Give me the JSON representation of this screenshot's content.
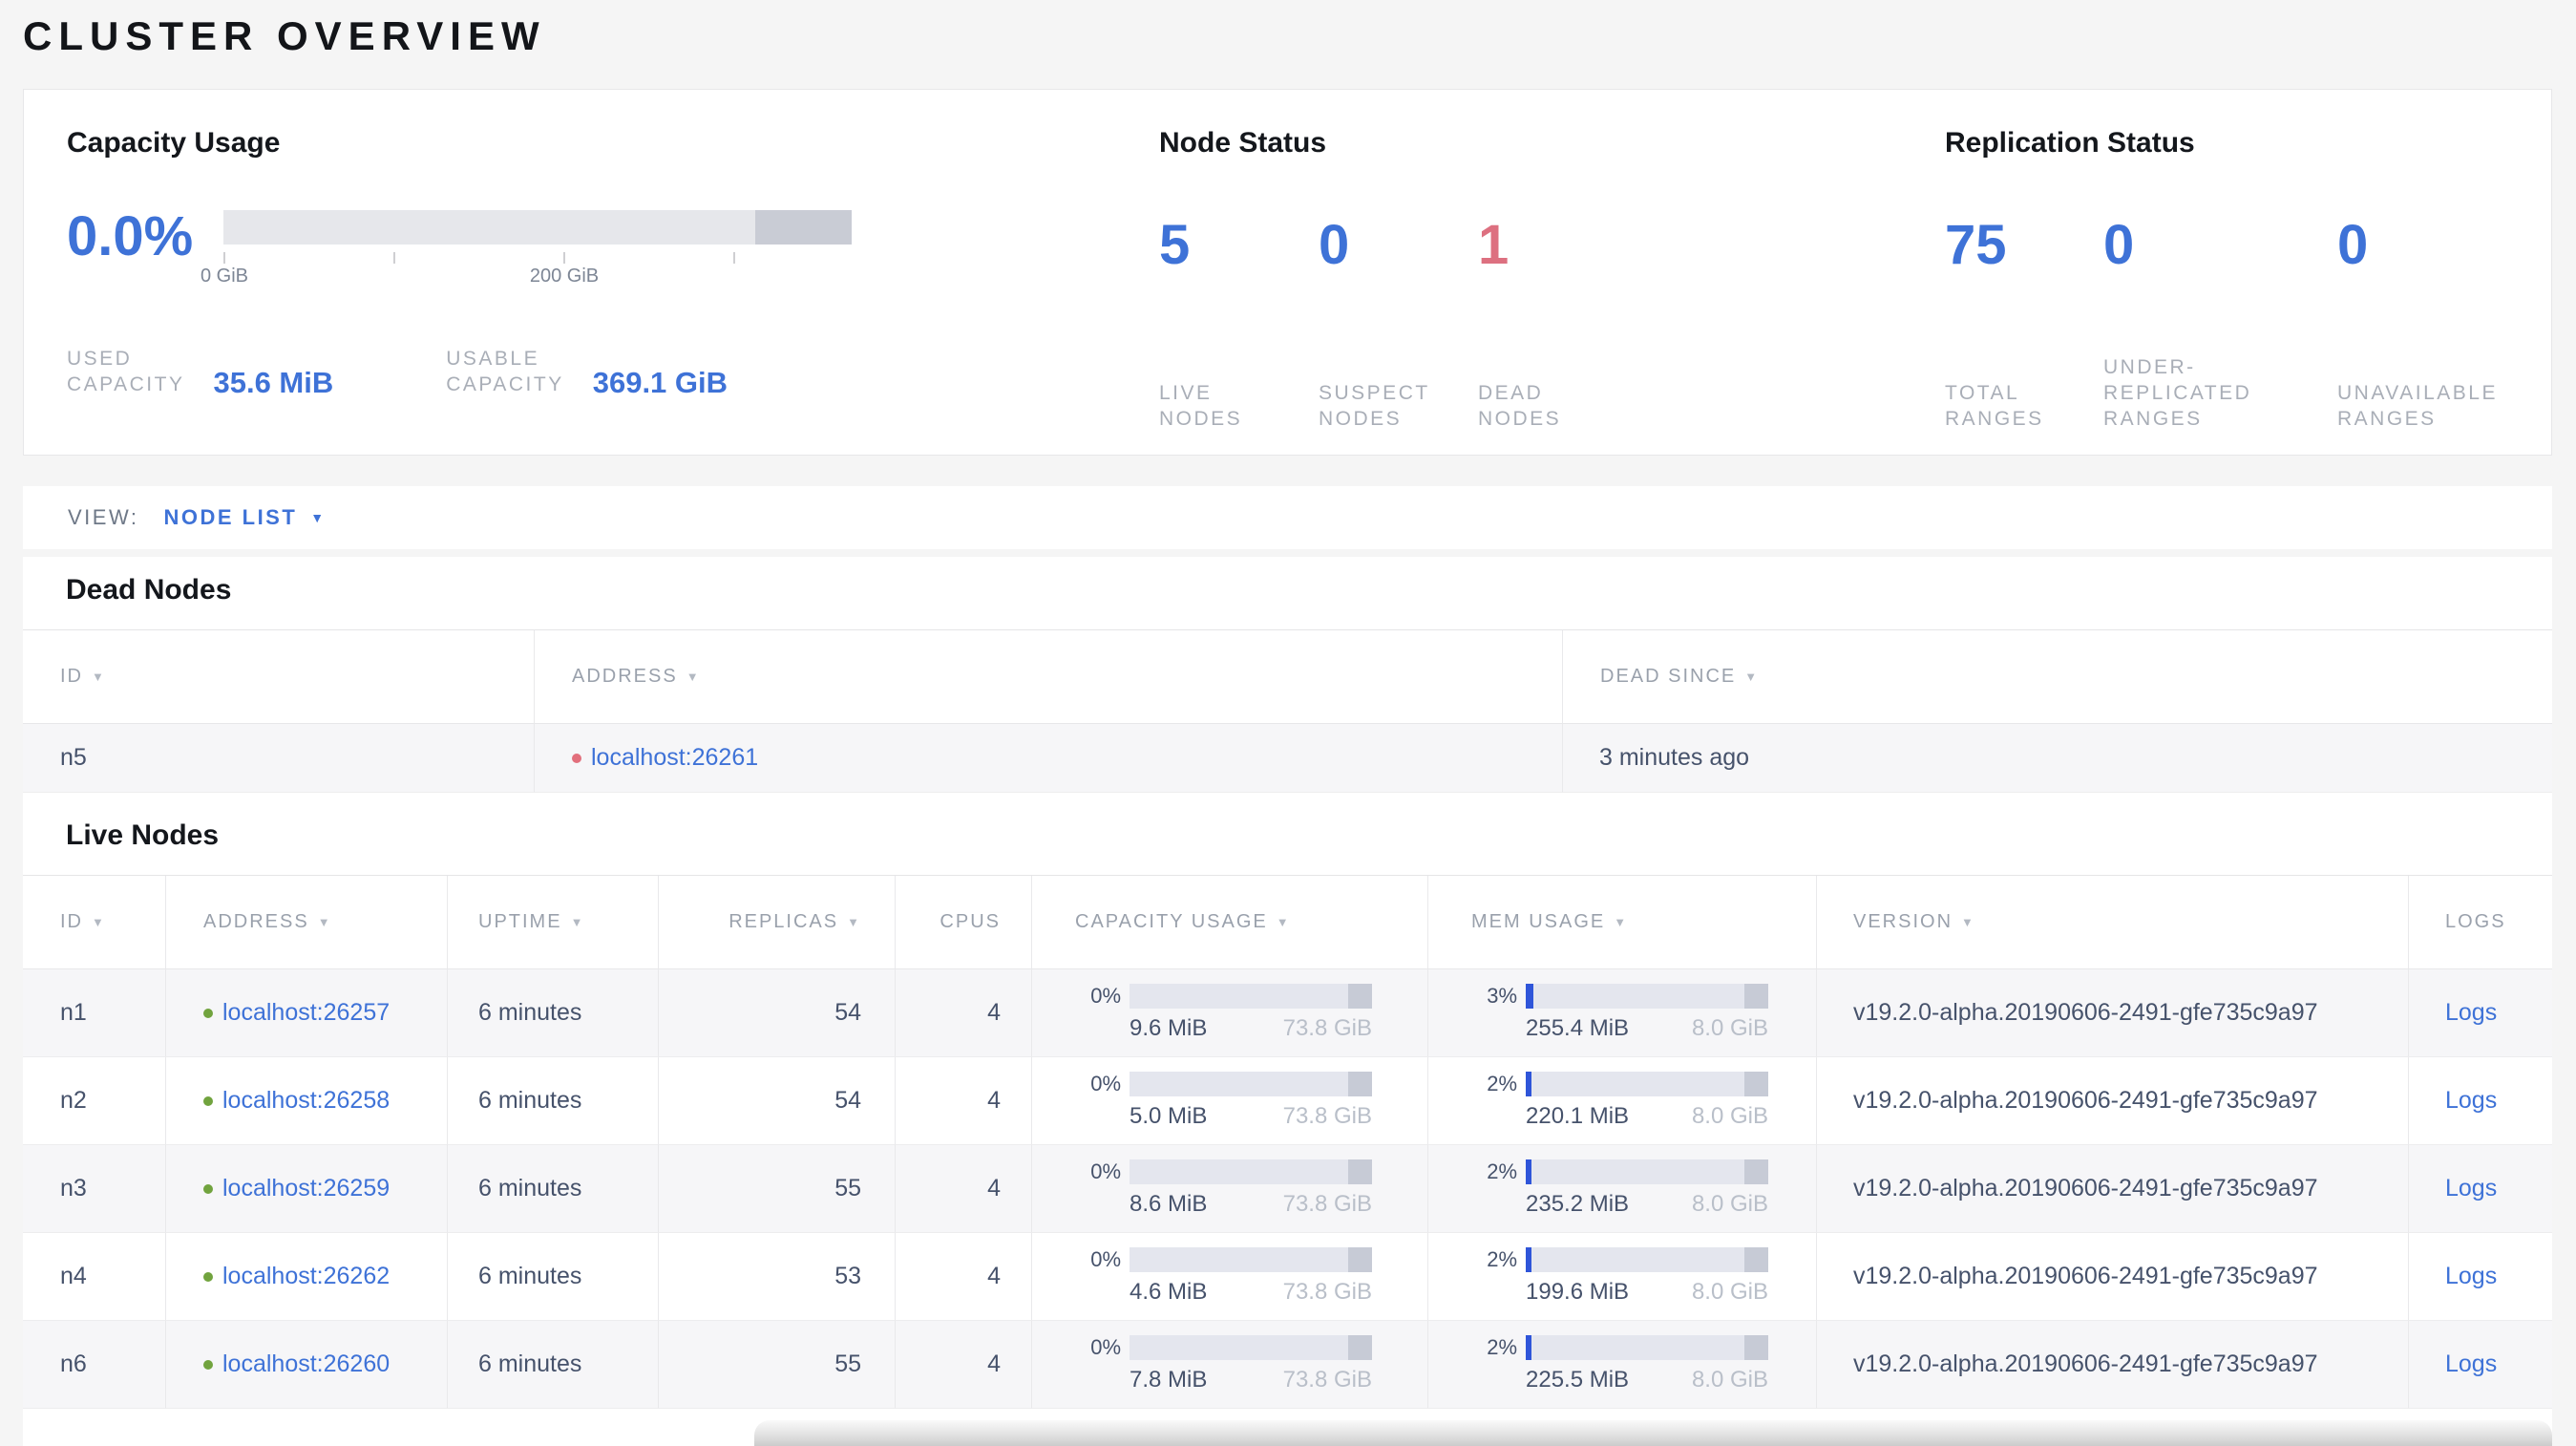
{
  "colors": {
    "accent_blue": "#3e72d7",
    "danger_red": "#dd7080",
    "live_dot_green": "#71a33e",
    "dead_dot_red": "#e26f7c",
    "mem_used_blue": "#2f55d9",
    "bar_background": "#e4e6ee",
    "bar_reserved": "#c7cbd6"
  },
  "header": {
    "title": "CLUSTER OVERVIEW"
  },
  "capacity": {
    "title": "Capacity Usage",
    "percent": "0.0%",
    "axis_labels": [
      "0 GiB",
      "200 GiB"
    ],
    "stats": [
      {
        "label_lines": [
          "USED",
          "CAPACITY"
        ],
        "value": "35.6 MiB"
      },
      {
        "label_lines": [
          "USABLE",
          "CAPACITY"
        ],
        "value": "369.1 GiB"
      }
    ]
  },
  "node_status": {
    "title": "Node Status",
    "stats": [
      {
        "value": "5",
        "label_lines": [
          "LIVE",
          "NODES"
        ],
        "tone": "blue"
      },
      {
        "value": "0",
        "label_lines": [
          "SUSPECT",
          "NODES"
        ],
        "tone": "blue"
      },
      {
        "value": "1",
        "label_lines": [
          "DEAD",
          "NODES"
        ],
        "tone": "red"
      }
    ]
  },
  "replication_status": {
    "title": "Replication Status",
    "stats": [
      {
        "value": "75",
        "label_lines": [
          "TOTAL",
          "RANGES"
        ],
        "tone": "blue"
      },
      {
        "value": "0",
        "label_lines": [
          "UNDER-",
          "REPLICATED",
          "RANGES"
        ],
        "tone": "blue"
      },
      {
        "value": "0",
        "label_lines": [
          "UNAVAILABLE",
          "RANGES"
        ],
        "tone": "blue"
      }
    ]
  },
  "view_bar": {
    "label": "VIEW:",
    "selected": "NODE LIST"
  },
  "dead_nodes": {
    "heading": "Dead Nodes",
    "columns": [
      {
        "label": "ID",
        "sortable": true
      },
      {
        "label": "ADDRESS",
        "sortable": true
      },
      {
        "label": "DEAD SINCE",
        "sortable": true
      }
    ],
    "rows": [
      {
        "id": "n5",
        "address": "localhost:26261",
        "dead_since": "3 minutes ago"
      }
    ]
  },
  "live_nodes": {
    "heading": "Live Nodes",
    "columns": [
      {
        "label": "ID",
        "sortable": true
      },
      {
        "label": "ADDRESS",
        "sortable": true
      },
      {
        "label": "UPTIME",
        "sortable": true
      },
      {
        "label": "REPLICAS",
        "sortable": true
      },
      {
        "label": "CPUS",
        "sortable": false
      },
      {
        "label": "CAPACITY USAGE",
        "sortable": true
      },
      {
        "label": "MEM USAGE",
        "sortable": true
      },
      {
        "label": "VERSION",
        "sortable": true
      },
      {
        "label": "LOGS",
        "sortable": false
      }
    ],
    "rows": [
      {
        "id": "n1",
        "address": "localhost:26257",
        "uptime": "6 minutes",
        "replicas": "54",
        "cpus": "4",
        "capacity": {
          "pct": "0%",
          "pct_num": 0,
          "used": "9.6 MiB",
          "total": "73.8 GiB"
        },
        "mem": {
          "pct": "3%",
          "pct_num": 3,
          "used": "255.4 MiB",
          "total": "8.0 GiB"
        },
        "version": "v19.2.0-alpha.20190606-2491-gfe735c9a97",
        "logs": "Logs"
      },
      {
        "id": "n2",
        "address": "localhost:26258",
        "uptime": "6 minutes",
        "replicas": "54",
        "cpus": "4",
        "capacity": {
          "pct": "0%",
          "pct_num": 0,
          "used": "5.0 MiB",
          "total": "73.8 GiB"
        },
        "mem": {
          "pct": "2%",
          "pct_num": 2,
          "used": "220.1 MiB",
          "total": "8.0 GiB"
        },
        "version": "v19.2.0-alpha.20190606-2491-gfe735c9a97",
        "logs": "Logs"
      },
      {
        "id": "n3",
        "address": "localhost:26259",
        "uptime": "6 minutes",
        "replicas": "55",
        "cpus": "4",
        "capacity": {
          "pct": "0%",
          "pct_num": 0,
          "used": "8.6 MiB",
          "total": "73.8 GiB"
        },
        "mem": {
          "pct": "2%",
          "pct_num": 2,
          "used": "235.2 MiB",
          "total": "8.0 GiB"
        },
        "version": "v19.2.0-alpha.20190606-2491-gfe735c9a97",
        "logs": "Logs"
      },
      {
        "id": "n4",
        "address": "localhost:26262",
        "uptime": "6 minutes",
        "replicas": "53",
        "cpus": "4",
        "capacity": {
          "pct": "0%",
          "pct_num": 0,
          "used": "4.6 MiB",
          "total": "73.8 GiB"
        },
        "mem": {
          "pct": "2%",
          "pct_num": 2,
          "used": "199.6 MiB",
          "total": "8.0 GiB"
        },
        "version": "v19.2.0-alpha.20190606-2491-gfe735c9a97",
        "logs": "Logs"
      },
      {
        "id": "n6",
        "address": "localhost:26260",
        "uptime": "6 minutes",
        "replicas": "55",
        "cpus": "4",
        "capacity": {
          "pct": "0%",
          "pct_num": 0,
          "used": "7.8 MiB",
          "total": "73.8 GiB"
        },
        "mem": {
          "pct": "2%",
          "pct_num": 2,
          "used": "225.5 MiB",
          "total": "8.0 GiB"
        },
        "version": "v19.2.0-alpha.20190606-2491-gfe735c9a97",
        "logs": "Logs"
      }
    ]
  }
}
